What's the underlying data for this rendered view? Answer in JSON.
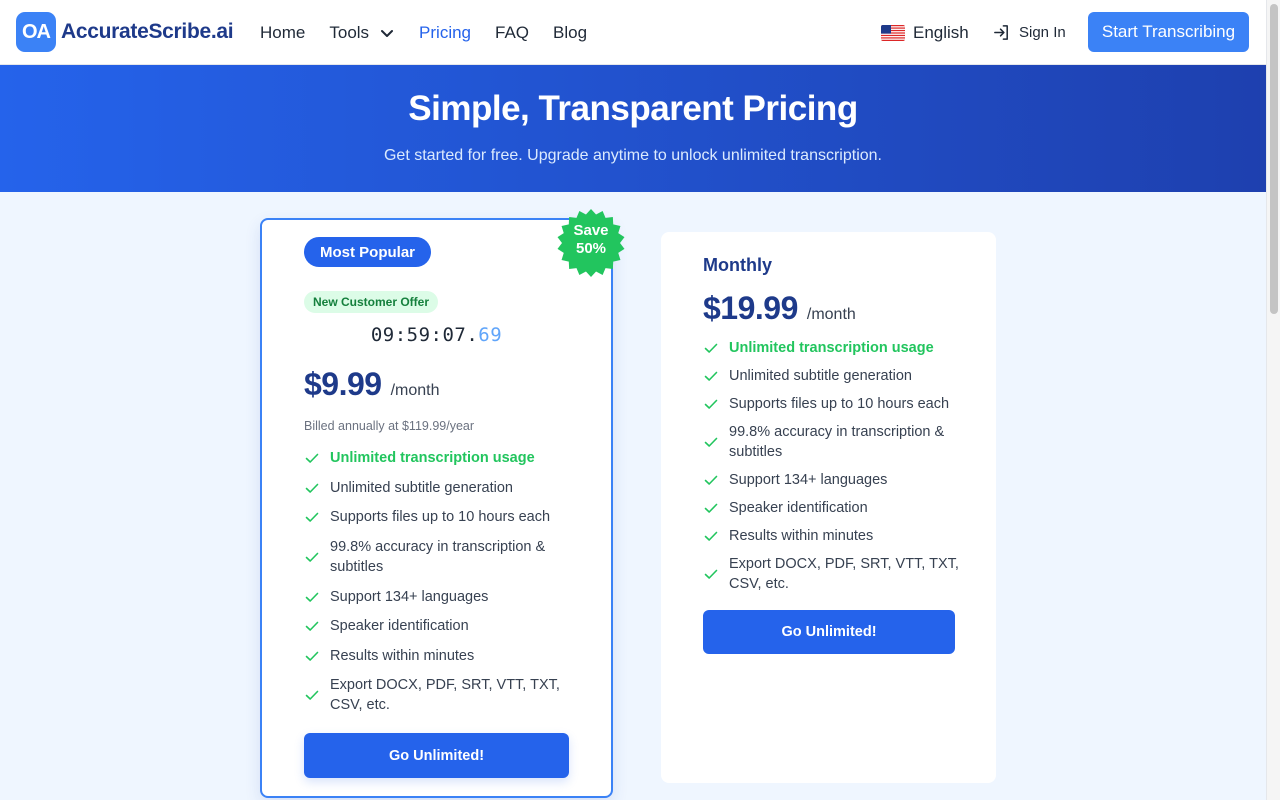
{
  "header": {
    "logo_mark": "OA",
    "logo_text": "AccurateScribe.ai",
    "nav": [
      {
        "label": "Home"
      },
      {
        "label": "Tools"
      },
      {
        "label": "Pricing"
      },
      {
        "label": "FAQ"
      },
      {
        "label": "Blog"
      }
    ],
    "language": "English",
    "sign_in": "Sign In",
    "cta": "Start Transcribing"
  },
  "hero": {
    "title": "Simple, Transparent Pricing",
    "subtitle": "Get started for free. Upgrade anytime to unlock unlimited transcription."
  },
  "annual_plan": {
    "badge": "Most Popular",
    "save_line1": "Save",
    "save_line2": "50%",
    "offer_tag": "New Customer Offer",
    "timer_main": "09:59:07.",
    "timer_ms": "69",
    "price": "$9.99",
    "period": "/month",
    "billed": "Billed annually at $119.99/year",
    "features": [
      "Unlimited transcription usage",
      "Unlimited subtitle generation",
      "Supports files up to 10 hours each",
      "99.8% accuracy in transcription & subtitles",
      "Support 134+ languages",
      "Speaker identification",
      "Results within minutes",
      "Export DOCX, PDF, SRT, VTT, TXT, CSV, etc."
    ],
    "button": "Go Unlimited!"
  },
  "monthly_plan": {
    "title": "Monthly",
    "price": "$19.99",
    "period": "/month",
    "features": [
      "Unlimited transcription usage",
      "Unlimited subtitle generation",
      "Supports files up to 10 hours each",
      "99.8% accuracy in transcription & subtitles",
      "Support 134+ languages",
      "Speaker identification",
      "Results within minutes",
      "Export DOCX, PDF, SRT, VTT, TXT, CSV, etc."
    ],
    "button": "Go Unlimited!"
  },
  "colors": {
    "brand": "#2563eb",
    "accent_green": "#22c55e",
    "heading": "#1e3a8a",
    "background": "#eff6ff"
  },
  "icons": {
    "nav_dropdown": "chevron-down-icon",
    "language": "us-flag-icon",
    "sign_in": "sign-in-icon",
    "feature": "check-icon"
  }
}
